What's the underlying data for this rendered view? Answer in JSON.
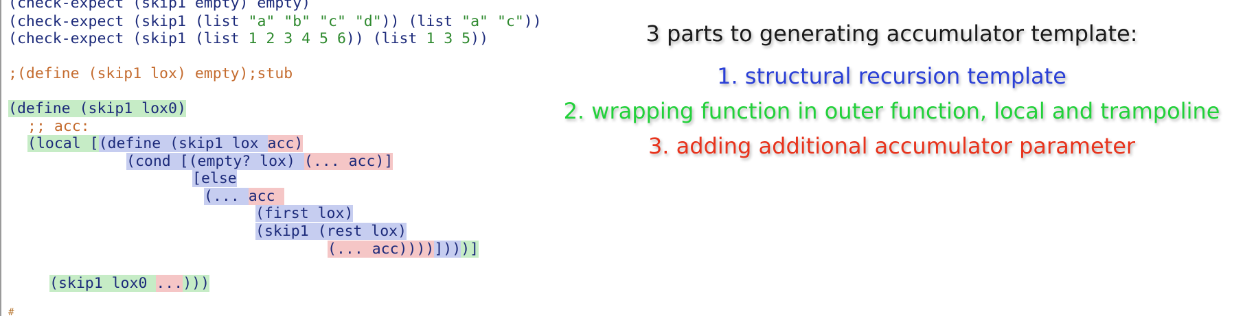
{
  "code": {
    "l1": "(check-expect (skip1 empty) empty)",
    "l2a": "(check-expect (skip1 (list ",
    "l2s": "\"a\" \"b\" \"c\" \"d\"",
    "l2b": ")) (list ",
    "l2s2": "\"a\" \"c\"",
    "l2c": "))",
    "l3a": "(check-expect (skip1 (list ",
    "l3n": "1 2 3 4 5 6",
    "l3b": ")) (list ",
    "l3n2": "1 3 5",
    "l3c": "))",
    "stub": ";(define (skip1 lox) empty);stub",
    "define_outer": "(define (skip1 lox0)",
    "acc_comment": ";; acc:",
    "local_open": "(local [",
    "define_inner": "(define (skip1 lox ",
    "acc_param": "acc)",
    "cond_open": "(cond [",
    "empty_check": "(empty? lox) ",
    "base_acc": "(... acc)",
    "base_close": "]",
    "else_open": "[else",
    "dots_open": "(... ",
    "acc_word": "acc ",
    "first_lox": "(first lox)",
    "skip_rest": "(skip1 (rest lox)",
    "rec_acc": "(... acc)",
    "rec_close_red": ")))",
    "rec_close_blue": "]))",
    "rec_close_green": ")]",
    "call_open": "(skip1 lox0 ",
    "call_dots": "...",
    "call_close": ")))",
    "cursor": "#"
  },
  "annotation": {
    "title": "3 parts to generating accumulator template:",
    "items": [
      {
        "text": "1. structural recursion template",
        "color": "#2a3fd6"
      },
      {
        "text": "2. wrapping function in outer function, local and trampoline",
        "color": "#22d13a"
      },
      {
        "text": "3. adding additional accumulator parameter",
        "color": "#e8331c"
      }
    ]
  }
}
